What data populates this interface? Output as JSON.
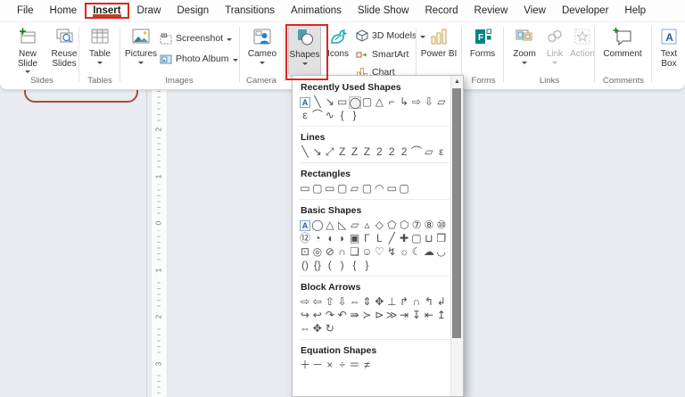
{
  "menu": {
    "items": [
      "File",
      "Home",
      "Insert",
      "Draw",
      "Design",
      "Transitions",
      "Animations",
      "Slide Show",
      "Record",
      "Review",
      "View",
      "Developer",
      "Help"
    ],
    "active": "Insert"
  },
  "ribbon": {
    "groups": [
      {
        "label": "Slides",
        "buttons": [
          {
            "label": "New Slide"
          },
          {
            "label": "Reuse Slides"
          }
        ]
      },
      {
        "label": "Tables",
        "buttons": [
          {
            "label": "Table"
          }
        ]
      },
      {
        "label": "Images",
        "buttons": [
          {
            "label": "Pictures"
          }
        ],
        "small": [
          {
            "label": "Screenshot"
          },
          {
            "label": "Photo Album"
          }
        ]
      },
      {
        "label": "Camera",
        "buttons": [
          {
            "label": "Cameo"
          }
        ]
      },
      {
        "label": "",
        "buttons": [
          {
            "label": "Shapes"
          },
          {
            "label": "Icons"
          }
        ],
        "small": [
          {
            "label": "3D Models"
          },
          {
            "label": "SmartArt"
          },
          {
            "label": "Chart"
          }
        ]
      },
      {
        "label": "",
        "buttons": [
          {
            "label": "Power BI"
          }
        ]
      },
      {
        "label": "Forms",
        "buttons": [
          {
            "label": "Forms"
          }
        ]
      },
      {
        "label": "Links",
        "buttons": [
          {
            "label": "Zoom"
          },
          {
            "label": "Link"
          },
          {
            "label": "Action"
          }
        ]
      },
      {
        "label": "Comments",
        "buttons": [
          {
            "label": "Comment"
          }
        ]
      },
      {
        "label": "",
        "buttons": [
          {
            "label": "Text Box"
          }
        ]
      }
    ]
  },
  "shapes_menu": {
    "sections": [
      {
        "title": "Recently Used Shapes",
        "rows": [
          [
            "A",
            "╲",
            "↘",
            "▭",
            "◯",
            "▢",
            "△",
            "⌐",
            "↳",
            "⇨",
            "⇩",
            "▱"
          ],
          [
            "ε",
            "⌒",
            "∿",
            "{",
            "}"
          ]
        ]
      },
      {
        "title": "Lines",
        "rows": [
          [
            "╲",
            "↘",
            "⤢",
            "Z",
            "Z",
            "Z",
            "2",
            "2",
            "2",
            "⌒",
            "▱",
            "ε"
          ]
        ]
      },
      {
        "title": "Rectangles",
        "rows": [
          [
            "▭",
            "▢",
            "▭",
            "▢",
            "▱",
            "▢",
            "◠",
            "▭",
            "▢"
          ]
        ]
      },
      {
        "title": "Basic Shapes",
        "rows": [
          [
            "A",
            "◯",
            "△",
            "◺",
            "▱",
            "▵",
            "◇",
            "⬠",
            "⬡",
            "⑦",
            "⑧",
            "⑩"
          ],
          [
            "⑫",
            "◔",
            "◖",
            "◗",
            "▣",
            "Γ",
            "L",
            "╱",
            "✚",
            "▢",
            "⊔",
            "❒"
          ],
          [
            "⊡",
            "◎",
            "⊘",
            "∩",
            "❏",
            "☺",
            "♡",
            "↯",
            "☼",
            "☾",
            "☁",
            "◡"
          ],
          [
            "()",
            "{}",
            "(",
            ")",
            "{",
            "}"
          ]
        ]
      },
      {
        "title": "Block Arrows",
        "rows": [
          [
            "⇨",
            "⇦",
            "⇧",
            "⇩",
            "⇔",
            "⇕",
            "✥",
            "⊥",
            "↱",
            "∩",
            "↰",
            "↲"
          ],
          [
            "↪",
            "↩",
            "↷",
            "↶",
            "⇛",
            "≻",
            "⊳",
            "≫",
            "⇥",
            "↧",
            "⇤",
            "↥"
          ],
          [
            "⇔",
            "✥",
            "↻"
          ]
        ]
      },
      {
        "title": "Equation Shapes",
        "rows": [
          [
            "＋",
            "－",
            "×",
            "÷",
            "＝",
            "≠"
          ]
        ]
      }
    ],
    "highlighted": {
      "section": 0,
      "row": 0,
      "index": 4
    }
  },
  "ruler": {
    "numbers": [
      "2",
      "1",
      "0",
      "1",
      "2",
      "3"
    ]
  },
  "icons": {
    "scroll_up": "▲"
  },
  "colors": {
    "annotation_red": "#e0251f",
    "annotation_dark_red": "#a94a3f",
    "active_tab_underline": "#b7472a",
    "shapes_teal": "#4e9fae",
    "forms_green": "#038387",
    "powerbi_gold": "#c9a257",
    "textbox_blue": "#2b579a"
  }
}
